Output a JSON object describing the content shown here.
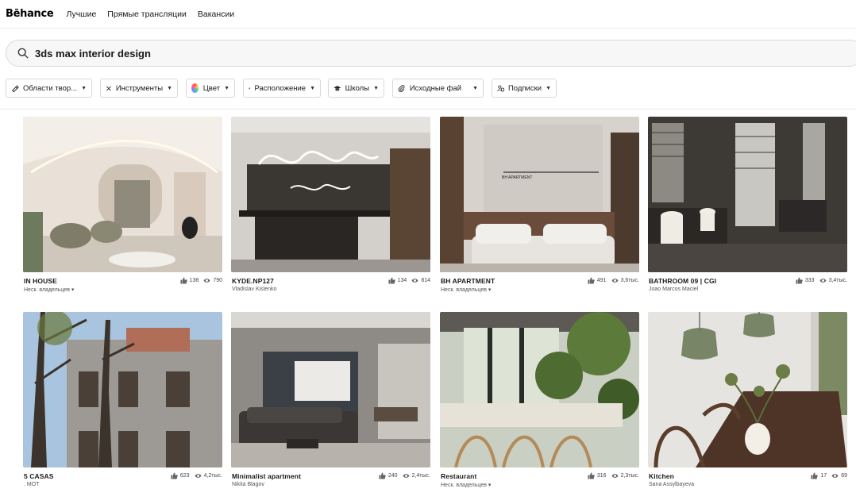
{
  "nav": {
    "logo": "Bēhance",
    "links": [
      "Лучшие",
      "Прямые трансляции",
      "Вакансии"
    ]
  },
  "search": {
    "value": "3ds max interior design"
  },
  "filters": [
    {
      "label": "Области твор...",
      "icon": "paint-icon"
    },
    {
      "label": "Инструменты",
      "icon": "tools-icon"
    },
    {
      "label": "Цвет",
      "icon": "color-wheel-icon"
    },
    {
      "label": "Расположение",
      "icon": "location-pin-icon"
    },
    {
      "label": "Школы",
      "icon": "graduation-cap-icon"
    },
    {
      "label": "Исходные фай",
      "icon": "paperclip-icon"
    },
    {
      "label": "Подписки",
      "icon": "subscription-icon"
    }
  ],
  "projects": [
    {
      "title": "IN HOUSE",
      "owner": "Неск. владельцев ▾",
      "likes": "138",
      "views": "790"
    },
    {
      "title": "KYDE.NP127",
      "owner": "Vladislav Kislenko",
      "likes": "134",
      "views": "814"
    },
    {
      "title": "BH APARTMENT",
      "owner": "Неск. владельцев ▾",
      "likes": "491",
      "views": "3,6тыс."
    },
    {
      "title": "BATHROOM 09 | CGI",
      "owner": "Joao Marcos Maciel",
      "likes": "333",
      "views": "3,4тыс."
    },
    {
      "title": "5 CASAS",
      "owner": ". MOT",
      "likes": "623",
      "views": "4,2тыс."
    },
    {
      "title": "Minimalist apartment",
      "owner": "Nikita Blagov",
      "likes": "240",
      "views": "2,4тыс."
    },
    {
      "title": "Restaurant",
      "owner": "Неск. владельцев ▾",
      "likes": "316",
      "views": "2,3тыс."
    },
    {
      "title": "Kitchen",
      "owner": "Sana Assylbayeva",
      "likes": "17",
      "views": "69"
    }
  ],
  "thumb_labels": {
    "bh_sign": "BH APARTMENT"
  }
}
